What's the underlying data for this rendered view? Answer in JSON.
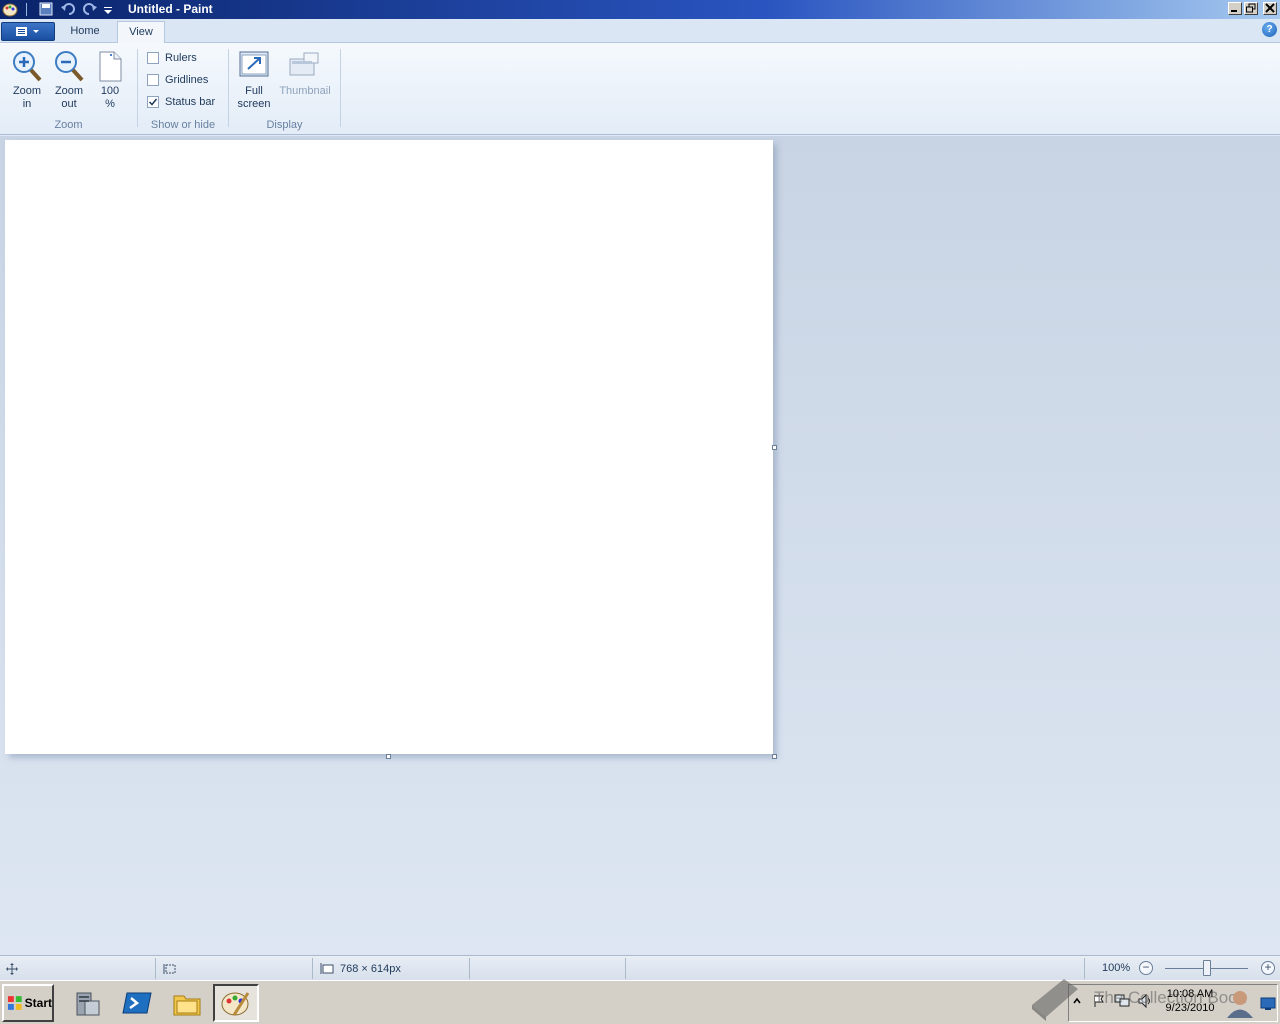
{
  "window": {
    "title": "Untitled - Paint"
  },
  "tabs": [
    {
      "label": "Home",
      "active": false
    },
    {
      "label": "View",
      "active": true
    }
  ],
  "ribbon": {
    "zoom_group": {
      "label": "Zoom",
      "zoom_in": "Zoom\nin",
      "zoom_out": "Zoom\nout",
      "hundred": "100\n%"
    },
    "show_hide_group": {
      "label": "Show or hide",
      "rulers": {
        "label": "Rulers",
        "checked": false
      },
      "gridlines": {
        "label": "Gridlines",
        "checked": false
      },
      "status_bar": {
        "label": "Status bar",
        "checked": true
      }
    },
    "display_group": {
      "label": "Display",
      "full_screen": "Full\nscreen",
      "thumbnail": "Thumbnail"
    }
  },
  "statusbar": {
    "image_size": "768 × 614px",
    "zoom_level": "100%",
    "zoom_out_symbol": "−",
    "zoom_in_symbol": "+"
  },
  "taskbar": {
    "start_label": "Start",
    "clock_time": "10:08 AM",
    "clock_date": "9/23/2010",
    "watermark": "The Collection Book"
  },
  "colors": {
    "title_bar": "#0a246a",
    "ribbon_bg": "#e3ecf7",
    "workspace_bg": "#c8d4e4",
    "accent": "#1e395b"
  }
}
